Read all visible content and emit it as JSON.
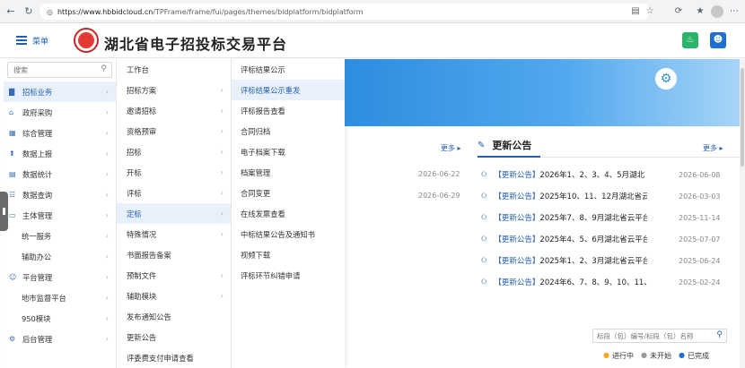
{
  "browser": {
    "url_host": "https://www.hbbidcloud.cn",
    "url_path": "/TPFrame/frame/fui/pages/themes/bidplatform/bidplatform"
  },
  "header": {
    "menu_label": "菜单",
    "site_title": "湖北省电子招投标交易平台",
    "bell_color": "#2ab36a",
    "user_color": "#1f6fd1"
  },
  "sidebar": {
    "search_placeholder": "搜索",
    "items": [
      {
        "label": "招标业务",
        "icon": "chart-icon",
        "active": true
      },
      {
        "label": "政府采购",
        "icon": "building-icon"
      },
      {
        "label": "综合管理",
        "icon": "grid-icon"
      },
      {
        "label": "数据上报",
        "icon": "upload-icon"
      },
      {
        "label": "数据统计",
        "icon": "stats-icon"
      },
      {
        "label": "数据查询",
        "icon": "query-icon"
      },
      {
        "label": "主体管理",
        "icon": "id-card-icon"
      },
      {
        "label": "统一服务",
        "icon": ""
      },
      {
        "label": "辅助办公",
        "icon": ""
      },
      {
        "label": "平台管理",
        "icon": "user-icon"
      },
      {
        "label": "地市监督平台",
        "icon": ""
      },
      {
        "label": "950模块",
        "icon": ""
      },
      {
        "label": "后台管理",
        "icon": "cog-icon"
      }
    ]
  },
  "submenu2": {
    "items": [
      {
        "label": "工作台",
        "chevron": false
      },
      {
        "label": "招标方案",
        "chevron": true
      },
      {
        "label": "邀请招标",
        "chevron": true
      },
      {
        "label": "资格预审",
        "chevron": true
      },
      {
        "label": "招标",
        "chevron": true
      },
      {
        "label": "开标",
        "chevron": true
      },
      {
        "label": "评标",
        "chevron": true
      },
      {
        "label": "定标",
        "chevron": true,
        "active": true
      },
      {
        "label": "特殊情况",
        "chevron": true
      },
      {
        "label": "书面报告备案",
        "chevron": false
      },
      {
        "label": "预制文件",
        "chevron": true
      },
      {
        "label": "辅助模块",
        "chevron": true
      },
      {
        "label": "发布通知公告",
        "chevron": false
      },
      {
        "label": "更新公告",
        "chevron": false
      },
      {
        "label": "评委费支付申请查看",
        "chevron": false
      }
    ]
  },
  "submenu3": {
    "items": [
      {
        "label": "评标结果公示"
      },
      {
        "label": "评标结果公示重发",
        "active": true
      },
      {
        "label": "评标报告查看"
      },
      {
        "label": "合同归档"
      },
      {
        "label": "电子档案下载"
      },
      {
        "label": "档案管理"
      },
      {
        "label": "合同变更"
      },
      {
        "label": "在线发票查看"
      },
      {
        "label": "中标结果公告及通知书"
      },
      {
        "label": "视频下载"
      },
      {
        "label": "评标环节纠错申请"
      }
    ]
  },
  "content": {
    "more_label": "更多",
    "left_dates": [
      "2026-06-22",
      "2026-06-29"
    ],
    "updates_title": "更新公告",
    "updates": [
      {
        "tag": "【更新公告】",
        "text": "2026年1、2、3、4、5月湖北",
        "date": "2026-06-08"
      },
      {
        "tag": "【更新公告】",
        "text": "2025年10、11、12月湖北省云",
        "date": "2026-03-03"
      },
      {
        "tag": "【更新公告】",
        "text": "2025年7、8、9月湖北省云平台",
        "date": "2025-11-14"
      },
      {
        "tag": "【更新公告】",
        "text": "2025年4、5、6月湖北省云平台",
        "date": "2025-07-07"
      },
      {
        "tag": "【更新公告】",
        "text": "2025年1、2、3月湖北省云平台",
        "date": "2025-06-24"
      },
      {
        "tag": "【更新公告】",
        "text": "2024年6、7、8、9、10、11、",
        "date": "2025-02-24"
      }
    ],
    "filter_placeholder": "标段（包）编号/标段（包）名称",
    "legend": [
      {
        "label": "进行中",
        "color": "#f5a623"
      },
      {
        "label": "未开始",
        "color": "#999999"
      },
      {
        "label": "已完成",
        "color": "#1f6fd1"
      }
    ]
  }
}
